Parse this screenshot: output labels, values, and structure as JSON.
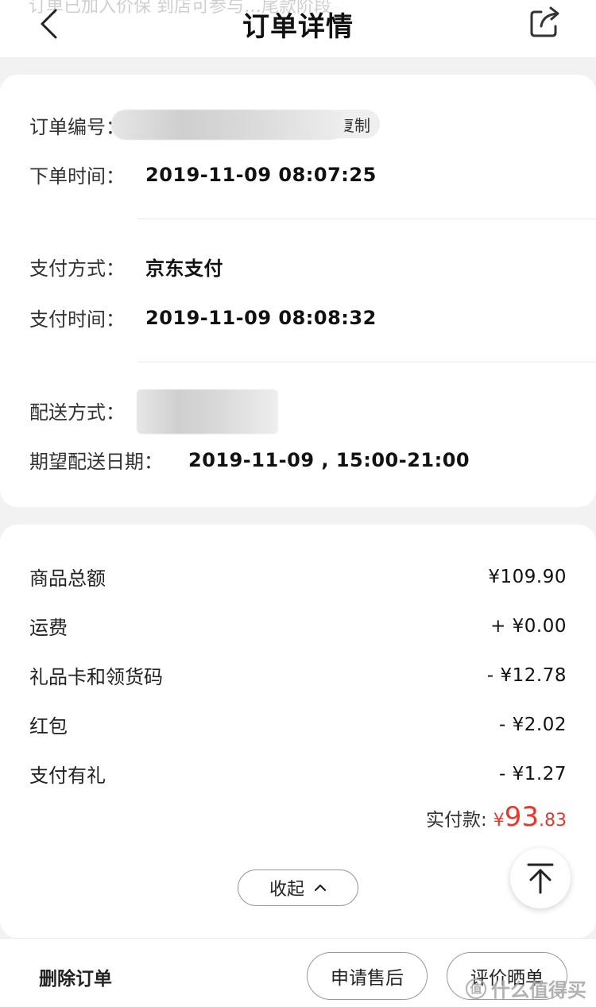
{
  "header": {
    "faded_banner": "订单已加入价保 到店可参与…尾款阶段",
    "title": "订单详情",
    "back_icon": "chevron-left-icon",
    "share_icon": "share-icon"
  },
  "order_info": {
    "order_no_label": "订单编号：",
    "copy_label": "复制",
    "order_time_label": "下单时间：",
    "order_time": "2019-11-09 08:07:25",
    "pay_method_label": "支付方式：",
    "pay_method": "京东支付",
    "pay_time_label": "支付时间：",
    "pay_time": "2019-11-09 08:08:32",
    "delivery_method_label": "配送方式：",
    "expected_date_label": "期望配送日期：",
    "expected_date": "2019-11-09 , 15:00-21:00"
  },
  "prices": [
    {
      "label": "商品总额",
      "value": "¥109.90"
    },
    {
      "label": "运费",
      "value": "+ ¥0.00"
    },
    {
      "label": "礼品卡和领货码",
      "value": "- ¥12.78"
    },
    {
      "label": "红包",
      "value": "- ¥2.02"
    },
    {
      "label": "支付有礼",
      "value": "- ¥1.27"
    }
  ],
  "paid": {
    "label": "实付款:",
    "currency": "¥",
    "integer": "93",
    "decimal": ".83",
    "color": "#e43a2d"
  },
  "collapse_label": "收起",
  "bottom": {
    "delete_label": "删除订单",
    "after_sale_label": "申请售后",
    "review_label": "评价晒单"
  },
  "watermark": {
    "badge": "值",
    "text": "什么值得买"
  }
}
